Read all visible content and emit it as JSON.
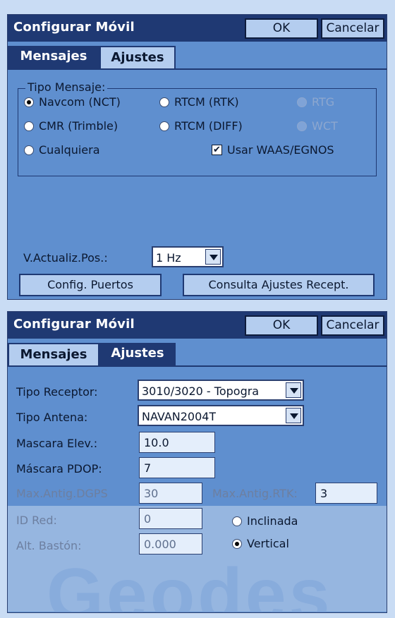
{
  "dialog1": {
    "title": "Configurar Móvil",
    "ok_label": "OK",
    "cancel_label": "Cancelar",
    "tabs": [
      {
        "label": "Mensajes"
      },
      {
        "label": "Ajustes"
      }
    ],
    "group_label": "Tipo Mensaje:",
    "radios": [
      {
        "label": "Navcom (NCT)",
        "checked": true
      },
      {
        "label": "RTCM (RTK)",
        "checked": false
      },
      {
        "label": "RTG",
        "checked": false,
        "disabled": true
      },
      {
        "label": "CMR (Trimble)",
        "checked": false
      },
      {
        "label": "RTCM (DIFF)",
        "checked": false
      },
      {
        "label": "WCT",
        "checked": false,
        "disabled": true
      },
      {
        "label": "Cualquiera",
        "checked": false
      }
    ],
    "waas_label": "Usar WAAS/EGNOS",
    "waas_checked": true,
    "rate_label": "V.Actualiz.Pos.:",
    "rate_value": "1 Hz",
    "ports_button": "Config. Puertos",
    "query_button": "Consulta Ajustes Recept."
  },
  "dialog2": {
    "title": "Configurar Móvil",
    "ok_label": "OK",
    "cancel_label": "Cancelar",
    "tabs": [
      {
        "label": "Mensajes"
      },
      {
        "label": "Ajustes"
      }
    ],
    "receiver_label": "Tipo Receptor:",
    "receiver_value": "3010/3020 - Topogra",
    "antenna_label": "Tipo Antena:",
    "antenna_value": "NAVAN2004T",
    "elev_label": "Mascara Elev.:",
    "elev_value": "10.0",
    "pdop_label": "Máscara PDOP:",
    "pdop_value": "7",
    "dgps_label": "Max.Antig.DGPS",
    "dgps_value": "30",
    "rtk_label": "Max.Antig.RTK:",
    "rtk_value": "3",
    "netid_label": "ID Red:",
    "netid_value": "0",
    "pole_label": "Alt. Bastón:",
    "pole_value": "0.000",
    "orientation": [
      {
        "label": "Inclinada",
        "checked": false
      },
      {
        "label": "Vertical",
        "checked": true
      }
    ]
  },
  "watermark": "Geodes",
  "icons": {
    "dropdown": "chevron-down-icon",
    "radio": "radio-icon",
    "checkbox": "checkbox-icon"
  },
  "colors": {
    "titlebar": "#1f3973",
    "panel": "#5f8fcf",
    "button": "#b4cdef"
  }
}
